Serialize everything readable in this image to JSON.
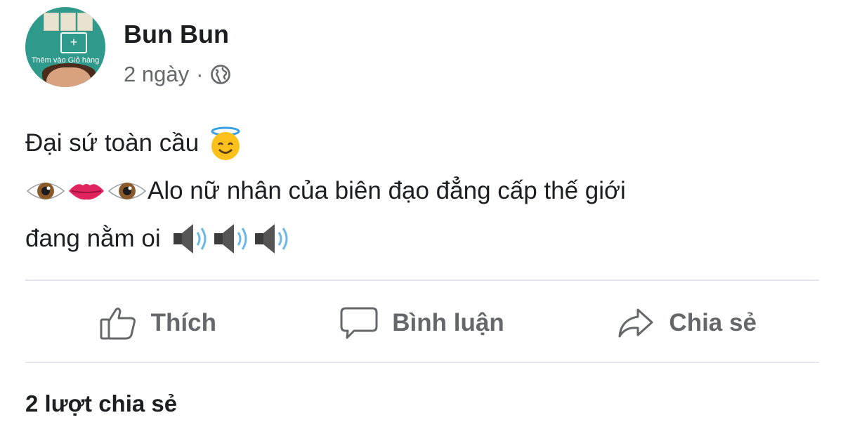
{
  "post": {
    "author": "Bun Bun",
    "avatar_text": "Thêm vào Giỏ hàng",
    "time": "2 ngày",
    "separator": "·",
    "privacy_icon": "globe-icon",
    "lines": [
      {
        "text": "Đại sứ toàn cầu",
        "emojis_after": [
          "smiling-face-with-halo"
        ]
      },
      {
        "text": "Alo nữ nhân của biên đạo đẳng cấp thế giới",
        "emojis_before": [
          "eye",
          "lips",
          "eye"
        ]
      },
      {
        "text": "đang nằm oi",
        "emojis_after": [
          "speaker-high-volume",
          "speaker-high-volume",
          "speaker-high-volume"
        ]
      }
    ]
  },
  "actions": {
    "like": {
      "label": "Thích",
      "icon": "thumbs-up-icon"
    },
    "comment": {
      "label": "Bình luận",
      "icon": "comment-bubble-icon"
    },
    "share": {
      "label": "Chia sẻ",
      "icon": "share-arrow-icon"
    }
  },
  "shares_count_text": "2 lượt chia sẻ",
  "colors": {
    "text": "#1c1e21",
    "secondary": "#65676b",
    "divider": "#e4e6eb"
  }
}
